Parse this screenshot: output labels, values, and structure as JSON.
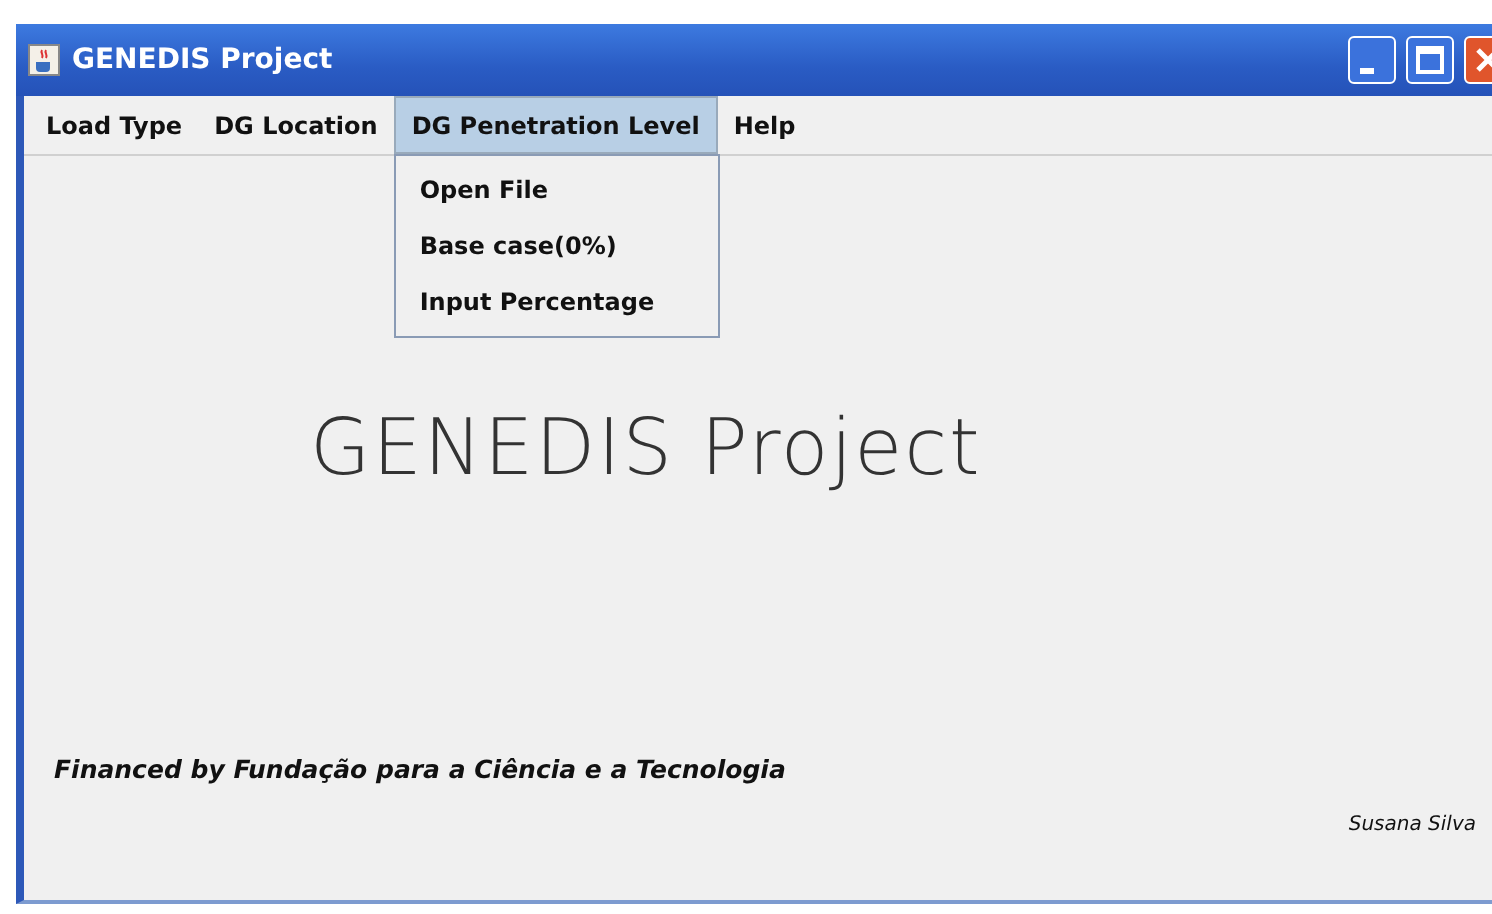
{
  "window": {
    "title": "GENEDIS Project"
  },
  "menu": [
    {
      "label": "Load Type",
      "selected": false
    },
    {
      "label": "DG Location",
      "selected": false
    },
    {
      "label": "DG Penetration Level",
      "selected": true,
      "items": [
        "Open File",
        "Base case(0%)",
        "Input Percentage"
      ]
    },
    {
      "label": "Help",
      "selected": false
    }
  ],
  "heading": "GENEDIS Project",
  "funding": "Financed by Fundação para a Ciência e a Tecnologia",
  "author": "Susana Silva"
}
